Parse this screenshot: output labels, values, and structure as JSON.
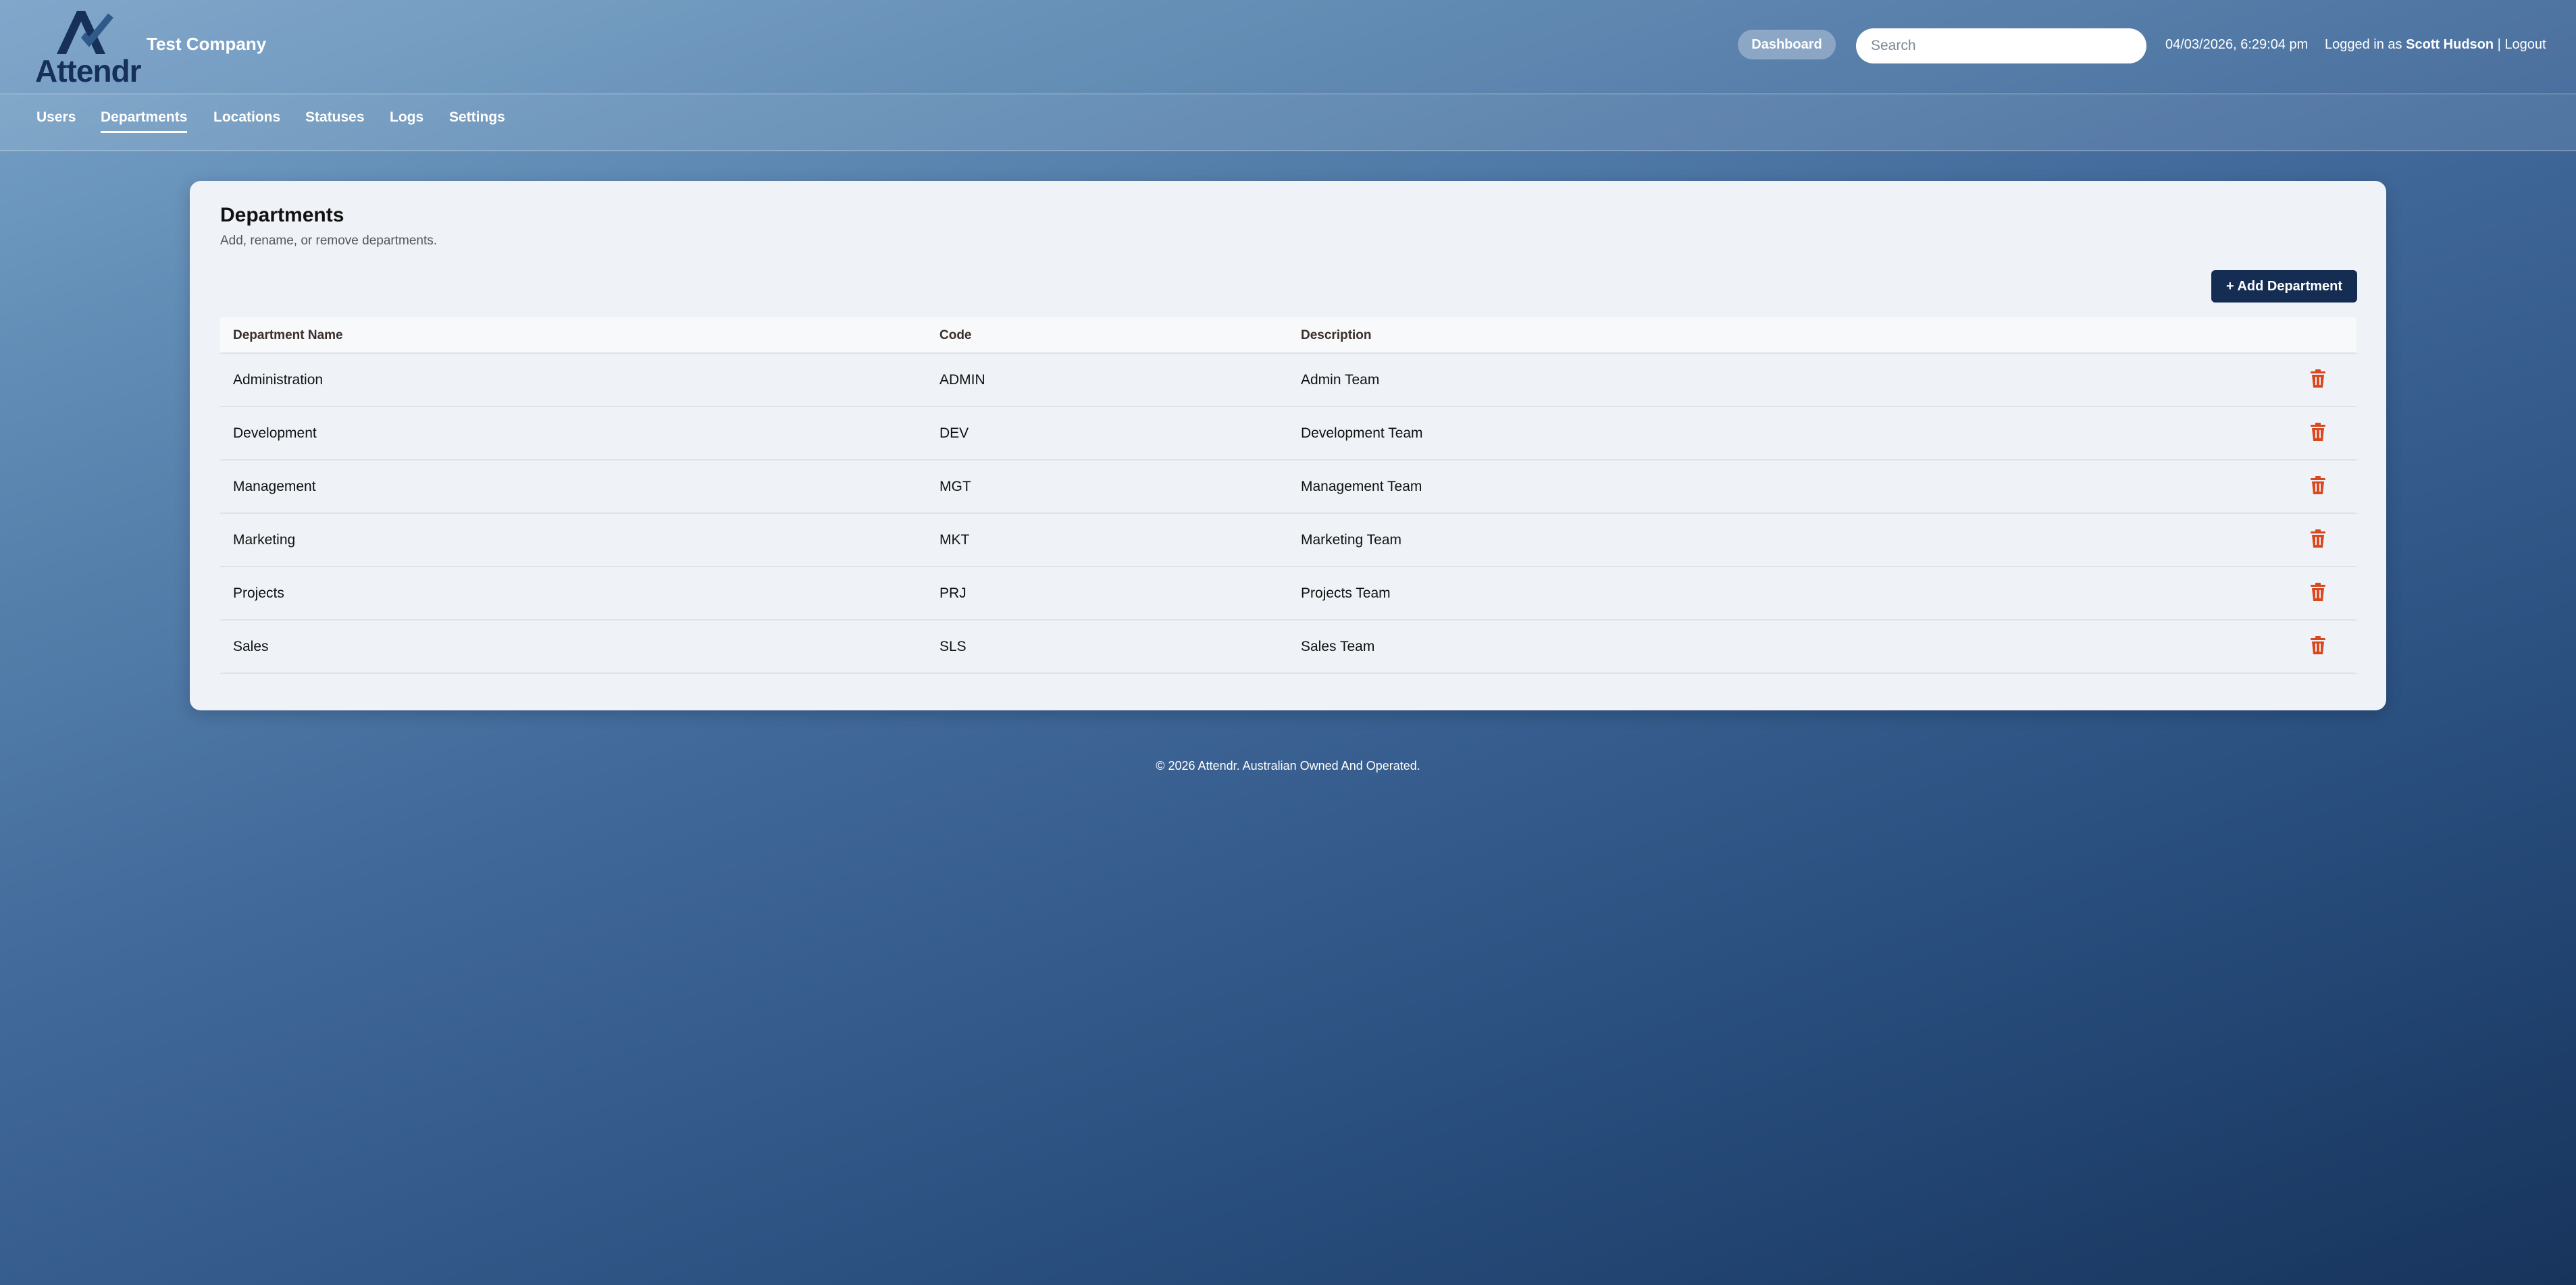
{
  "header": {
    "logo_text": "Attendr",
    "company_name": "Test Company",
    "dashboard_label": "Dashboard",
    "search_placeholder": "Search",
    "datetime": "04/03/2026, 6:29:04 pm",
    "logged_in_prefix": "Logged in as ",
    "user_name": "Scott Hudson",
    "separator": " | ",
    "logout_label": "Logout"
  },
  "nav": {
    "items": [
      {
        "label": "Users"
      },
      {
        "label": "Departments"
      },
      {
        "label": "Locations"
      },
      {
        "label": "Statuses"
      },
      {
        "label": "Logs"
      },
      {
        "label": "Settings"
      }
    ],
    "active": "Departments"
  },
  "page": {
    "title": "Departments",
    "subtitle": "Add, rename, or remove departments.",
    "add_button": "+ Add Department"
  },
  "table": {
    "columns": [
      "Department Name",
      "Code",
      "Description"
    ],
    "rows": [
      {
        "name": "Administration",
        "code": "ADMIN",
        "description": "Admin Team"
      },
      {
        "name": "Development",
        "code": "DEV",
        "description": "Development Team"
      },
      {
        "name": "Management",
        "code": "MGT",
        "description": "Management Team"
      },
      {
        "name": "Marketing",
        "code": "MKT",
        "description": "Marketing Team"
      },
      {
        "name": "Projects",
        "code": "PRJ",
        "description": "Projects Team"
      },
      {
        "name": "Sales",
        "code": "SLS",
        "description": "Sales Team"
      }
    ],
    "delete_icon": "trash-icon"
  },
  "footer": {
    "text": "© 2026 Attendr. Australian Owned And Operated."
  },
  "colors": {
    "brand_navy": "#152d52",
    "delete_red": "#d9481f"
  }
}
